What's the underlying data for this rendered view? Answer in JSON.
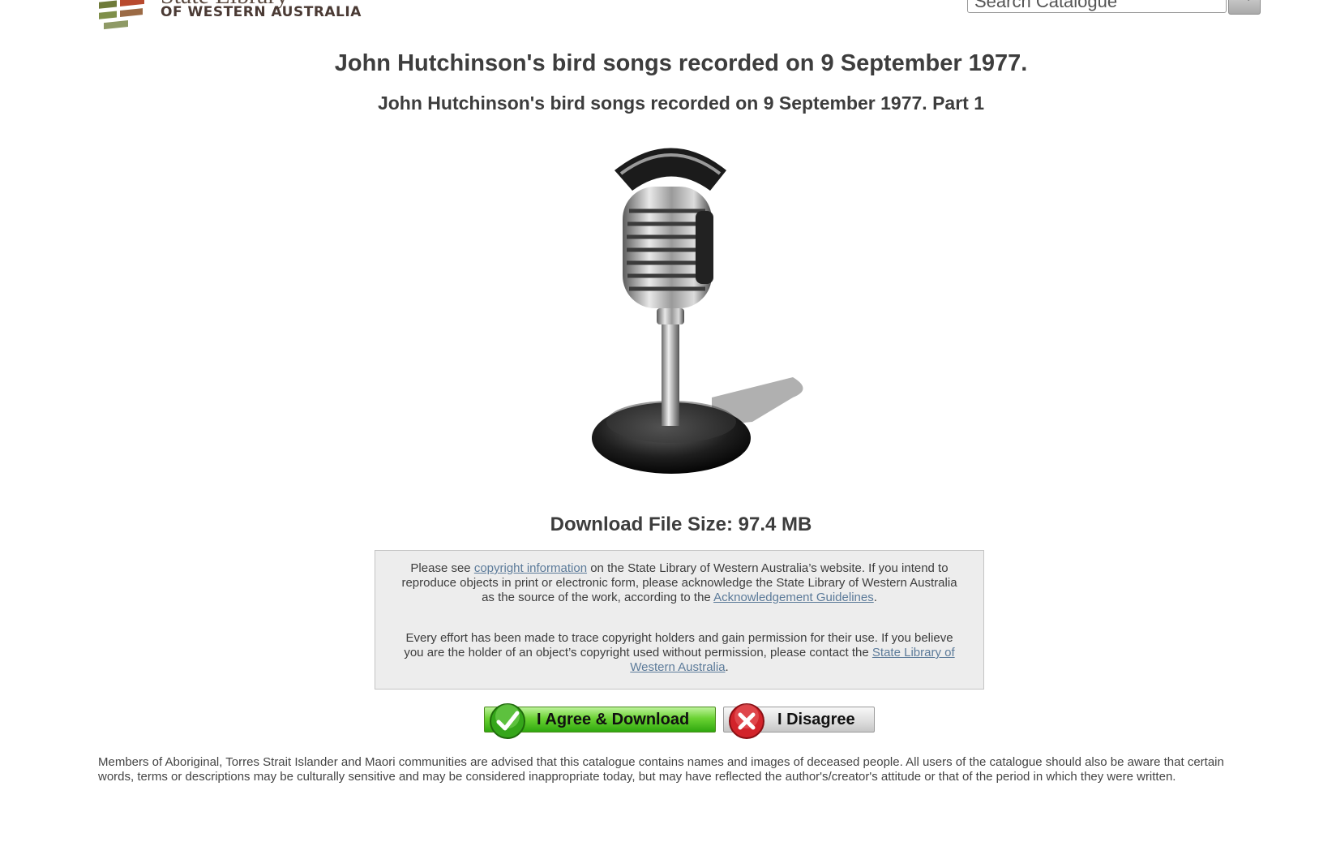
{
  "header": {
    "logo_top": "State Library",
    "logo_sub": "OF WESTERN AUSTRALIA",
    "search_value": "Search Catalogue"
  },
  "record": {
    "title": "John Hutchinson's bird songs recorded on 9 September 1977.",
    "subtitle": "John Hutchinson's bird songs recorded on 9 September 1977. Part 1",
    "file_size": "Download File Size: 97.4 MB"
  },
  "notice": {
    "p1_before": "Please see ",
    "p1_link": "copyright information",
    "p1_middle": " on the State Library of Western Australia’s website. If you intend to reproduce objects in print or electronic form, please acknowledge the State Library of Western Australia as the source of the work, according to the ",
    "p1_link2": "Acknowledgement Guidelines",
    "p1_after": ".",
    "p2_before": "Every effort has been made to trace copyright holders and gain permission for their use. If you believe you are the holder of an object’s copyright used without permission, please contact the ",
    "p2_link": "State Library of Western Australia",
    "p2_after": "."
  },
  "actions": {
    "agree_label": "I Agree & Download",
    "disagree_label": "I Disagree"
  },
  "disclaimer": "Members of Aboriginal, Torres Strait Islander and Maori communities are advised that this catalogue contains names and images of deceased people. All users of the catalogue should also be aware that certain words, terms or descriptions may be culturally sensitive and may be considered inappropriate today, but may have reflected the author's/creator's attitude or that of the period in which they were written.",
  "colors": {
    "link": "#5b7a99",
    "agree_green": "#2fa80f",
    "disagree_red": "#d2232a",
    "notice_bg": "#ededed"
  },
  "icons": {
    "logo": "library-logo-icon",
    "search": "search-icon",
    "media": "microphone-icon",
    "agree": "checkmark-icon",
    "disagree": "close-icon"
  }
}
